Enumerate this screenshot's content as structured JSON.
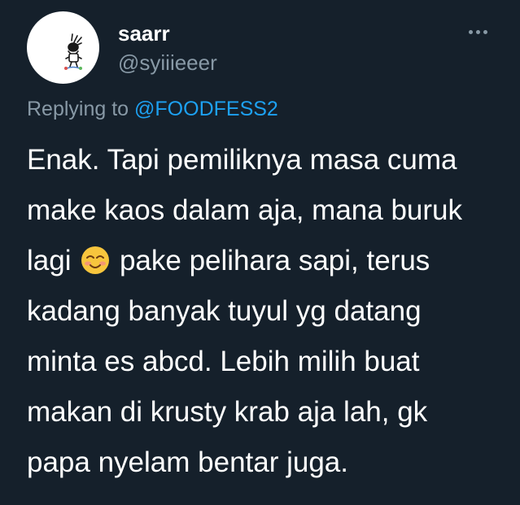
{
  "user": {
    "display_name": "saarr",
    "handle": "@syiiieeer"
  },
  "reply": {
    "prefix": "Replying to",
    "mention": "@FOODFESS2"
  },
  "tweet": {
    "lines": [
      "Enak. Tapi pemiliknya masa cuma",
      "make kaos dalam aja, mana buruk",
      "lagi",
      "pake pelihara sapi, terus",
      "kadang banyak tuyul yg datang",
      "minta es abcd. Lebih milih buat",
      "makan di krusty krab aja lah, gk",
      "papa nyelam bentar juga."
    ],
    "emoji": "smiling-blushing-face-emoji"
  },
  "icons": {
    "more": "more-horizontal-icon"
  },
  "colors": {
    "background": "#15202b",
    "primary_text": "#ffffff",
    "secondary_text": "#8899a6",
    "link": "#1da1f2"
  }
}
